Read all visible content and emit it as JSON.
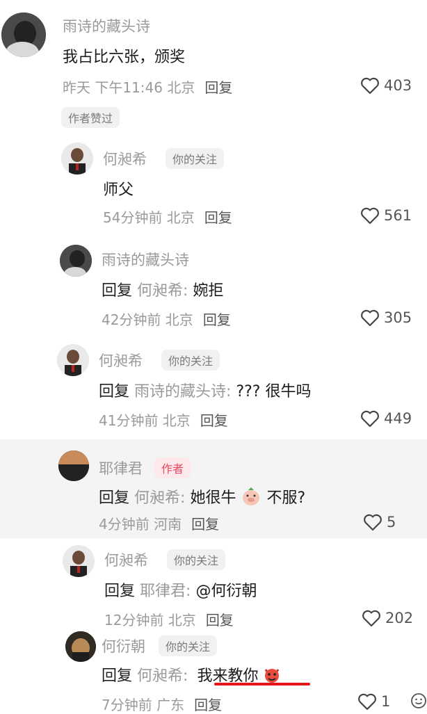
{
  "comments": [
    {
      "name": "雨诗的藏头诗",
      "badge": "",
      "body": "我占比六张，颁奖",
      "time": "昨天 下午11:46 北京",
      "reply": "回复",
      "likes": "403",
      "author_badge": "作者赞过"
    },
    {
      "name": "何昶希",
      "badge": "你的关注",
      "body": "师父",
      "time": "54分钟前 北京",
      "reply": "回复",
      "likes": "561"
    },
    {
      "name": "雨诗的藏头诗",
      "badge": "",
      "reply_prefix": "回复",
      "reply_target": "何昶希:",
      "body": "婉拒",
      "time": "42分钟前 北京",
      "reply": "回复",
      "likes": "305"
    },
    {
      "name": "何昶希",
      "badge": "你的关注",
      "reply_prefix": "回复",
      "reply_target": "雨诗的藏头诗:",
      "body": "??? 很牛吗",
      "time": "41分钟前 北京",
      "reply": "回复",
      "likes": "449"
    },
    {
      "name": "耶律君",
      "badge": "作者",
      "reply_prefix": "回复",
      "reply_target": "何昶希:",
      "body": "她很牛",
      "body2": "不服?",
      "time": "4分钟前 河南",
      "reply": "回复",
      "likes": "5"
    },
    {
      "name": "何昶希",
      "badge": "你的关注",
      "reply_prefix": "回复",
      "reply_target": "耶律君:",
      "body": "@何衍朝",
      "time": "12分钟前 北京",
      "reply": "回复",
      "likes": "202"
    },
    {
      "name": "何衍朝",
      "badge": "你的关注",
      "reply_prefix": "回复",
      "reply_target": "何昶希:",
      "body": "我来教你",
      "time": "7分钟前 广东",
      "reply": "回复",
      "likes": "1"
    }
  ],
  "colors": {
    "accent_red": "#e2161b",
    "author_pink": "#e8485e",
    "meta_gray": "#9a9a9a"
  },
  "icons": {
    "like": "heart-outline-icon",
    "emoji": "smiley-face-icon",
    "pig": "pig-sticker-icon",
    "devil": "devil-emoji-icon"
  }
}
